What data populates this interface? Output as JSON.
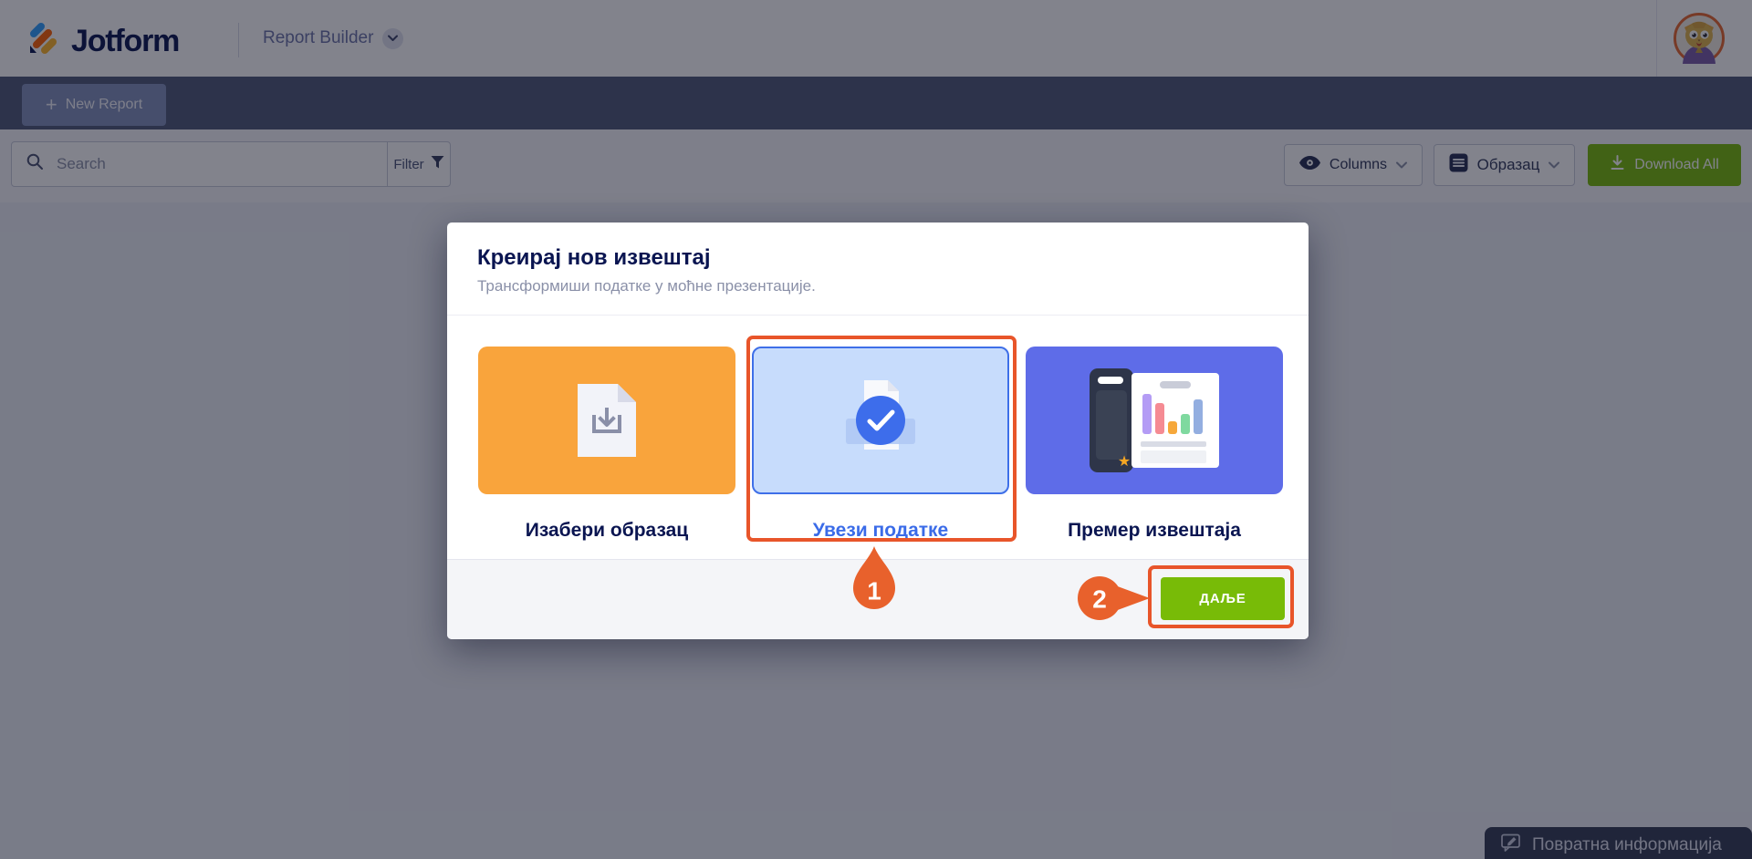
{
  "header": {
    "brand": "Jotform",
    "product": "Report Builder"
  },
  "navbar": {
    "new_report_plus": "+",
    "new_report_label": "New Report"
  },
  "toolbar": {
    "search_placeholder": "Search",
    "filter_label": "Filter",
    "columns_label": "Columns",
    "form_select_label": "Образац",
    "download_all_label": "Download All"
  },
  "modal": {
    "title": "Креирај нов извештај",
    "subtitle": "Трансформиши податке у моћне презентације.",
    "options": [
      {
        "label": "Изабери образац",
        "selected": false
      },
      {
        "label": "Увези податке",
        "selected": true
      },
      {
        "label": "Премер извештаја",
        "selected": false
      }
    ],
    "next_label": "ДАЉЕ"
  },
  "annotations": {
    "step1": "1",
    "step2": "2"
  },
  "feedback": {
    "label": "Повратна информација"
  },
  "colors": {
    "annotation_orange": "#E8552A",
    "selected_blue": "#3E6FE8",
    "action_green": "#78BB07",
    "card_orange": "#F9A43C",
    "card_indigo": "#5E6CE8",
    "brand_navy": "#0A1551"
  }
}
